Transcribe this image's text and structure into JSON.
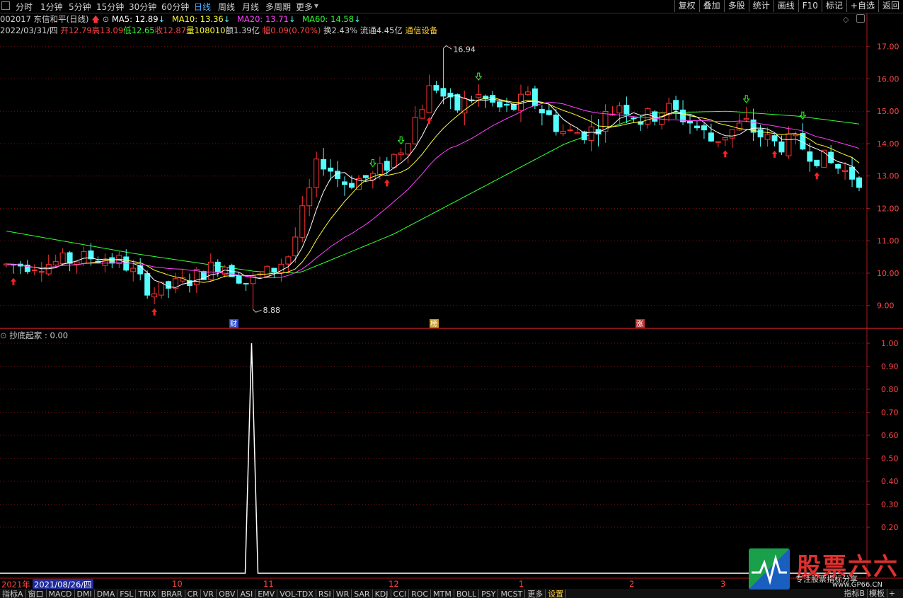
{
  "toolbar": {
    "periods": [
      "分时",
      "1分钟",
      "5分钟",
      "15分钟",
      "30分钟",
      "60分钟",
      "日线",
      "周线",
      "月线",
      "多周期",
      "更多"
    ],
    "active_period": "日线",
    "right_buttons": [
      "复权",
      "叠加",
      "多股",
      "统计",
      "画线",
      "F10",
      "标记",
      "+自选",
      "返回"
    ]
  },
  "stock": {
    "code_name": "002017 东信和平(日线)",
    "ma": [
      {
        "label": "MA5: 12.89",
        "color": "#ffffff"
      },
      {
        "label": "MA10: 13.36",
        "color": "#ffff33"
      },
      {
        "label": "MA20: 13.71",
        "color": "#ff44ff"
      },
      {
        "label": "MA60: 14.58",
        "color": "#33ff33"
      }
    ],
    "date": "2022/03/31/四",
    "open": "开12.79",
    "high": "高13.09",
    "low": "低12.65",
    "close": "收12.87",
    "volume": "量108010",
    "amount": "额1.39亿",
    "change": "幅0.09(0.70%)",
    "turnover": "换2.43%",
    "float_cap": "流通4.45亿",
    "sector": "通信设备"
  },
  "price_axis": {
    "min": 8.6,
    "max": 17.3,
    "ticks": [
      "17.00",
      "16.00",
      "15.00",
      "14.00",
      "13.00",
      "12.00",
      "11.00",
      "10.00",
      "9.00"
    ]
  },
  "annotations": {
    "max_label": "16.94",
    "min_label": "8.88",
    "event_markers": [
      "财",
      "榜",
      "涨"
    ]
  },
  "indicator": {
    "title": "抄底起家 : 0.00",
    "ticks": [
      "1.00",
      "0.90",
      "0.80",
      "0.70",
      "0.60",
      "0.50",
      "0.40",
      "0.30",
      "0.20"
    ],
    "spike_value": 1.0
  },
  "time_axis": {
    "year_label": "2021年",
    "cursor_date": "2021/08/26/四",
    "months": [
      "10",
      "11",
      "12",
      "1",
      "2",
      "3"
    ]
  },
  "tabs": [
    "指标A",
    "窗口",
    "MACD",
    "DMI",
    "DMA",
    "FSL",
    "TRIX",
    "BRAR",
    "CR",
    "VR",
    "OBV",
    "ASI",
    "EMV",
    "VOL-TDX",
    "RSI",
    "WR",
    "SAR",
    "KDJ",
    "CCI",
    "ROC",
    "MTM",
    "BOLL",
    "PSY",
    "MCST",
    "更多",
    "设置"
  ],
  "right_tabs": [
    "指标B",
    "模板"
  ],
  "logo": {
    "brand": "股票六六",
    "site": "www.GP66.CN",
    "slogan": "专注股票指标分享"
  },
  "colors": {
    "up": "#ff3333",
    "down": "#54ffff",
    "ma5": "#ffffff",
    "ma10": "#ffff33",
    "ma20": "#ff44ff",
    "ma60": "#33ff33",
    "grid": "#7a1010",
    "axis": "#aa1a1a"
  },
  "chart_data": {
    "type": "candlestick",
    "start_price": 10.25,
    "candle_count": 122,
    "price_path": [
      [
        0,
        10.25
      ],
      [
        10,
        10.3
      ],
      [
        20,
        10.5
      ],
      [
        27,
        10.35
      ],
      [
        34,
        9.4
      ],
      [
        42,
        9.75
      ],
      [
        50,
        10.35
      ],
      [
        56,
        9.7
      ],
      [
        62,
        10.1
      ],
      [
        66,
        10.6
      ],
      [
        70,
        12.3
      ],
      [
        73,
        13.6
      ],
      [
        78,
        12.8
      ],
      [
        86,
        13.0
      ],
      [
        92,
        13.9
      ],
      [
        98,
        15.6
      ],
      [
        100,
        15.8
      ],
      [
        104,
        15.0
      ],
      [
        109,
        15.5
      ],
      [
        116,
        15.0
      ],
      [
        122,
        15.4
      ],
      [
        130,
        14.3
      ],
      [
        136,
        14.4
      ],
      [
        143,
        15.3
      ],
      [
        148,
        14.7
      ],
      [
        153,
        15.1
      ],
      [
        158,
        14.8
      ],
      [
        164,
        14.1
      ],
      [
        172,
        14.6
      ],
      [
        178,
        14.0
      ],
      [
        184,
        14.0
      ],
      [
        190,
        13.5
      ],
      [
        197,
        13.0
      ],
      [
        200,
        12.87
      ]
    ],
    "ma60_path": [
      [
        0,
        11.3
      ],
      [
        30,
        10.6
      ],
      [
        58,
        10.05
      ],
      [
        68,
        10.0
      ],
      [
        90,
        11.2
      ],
      [
        110,
        12.6
      ],
      [
        130,
        14.0
      ],
      [
        150,
        14.95
      ],
      [
        168,
        15.0
      ],
      [
        184,
        14.85
      ],
      [
        200,
        14.58
      ]
    ],
    "extremes": {
      "high": 16.94,
      "low": 8.88
    },
    "indicator_series": {
      "name": "抄底起家",
      "baseline": 0,
      "spike_at_fraction": 0.286,
      "spike_value": 1.0
    }
  }
}
